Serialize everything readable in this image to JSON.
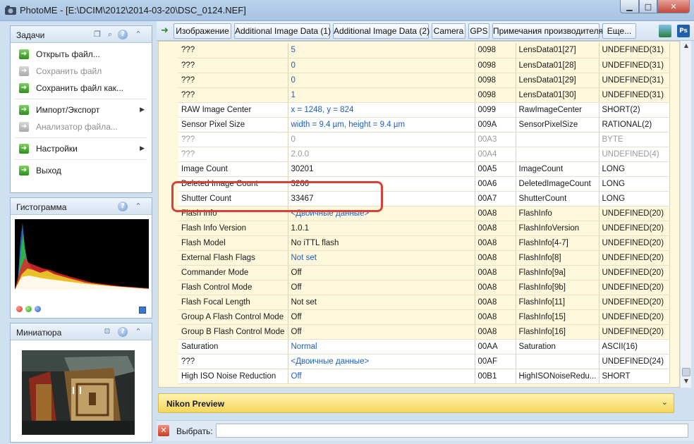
{
  "window": {
    "title": "PhotoME - [E:\\DCIM\\2012\\2014-03-20\\DSC_0124.NEF]",
    "minimize": "▁",
    "maximize": "□",
    "close": "✕"
  },
  "tasks": {
    "title": "Задачи",
    "items": [
      {
        "label": "Открыть файл...",
        "enabled": true
      },
      {
        "label": "Сохранить файл",
        "enabled": false
      },
      {
        "label": "Сохранить файл как...",
        "enabled": true
      },
      {
        "label": "Импорт/Экспорт",
        "enabled": true,
        "submenu": true
      },
      {
        "label": "Анализатор файла...",
        "enabled": false
      },
      {
        "label": "Настройки",
        "enabled": true,
        "submenu": true
      },
      {
        "label": "Выход",
        "enabled": true
      }
    ]
  },
  "histogram": {
    "title": "Гистограмма"
  },
  "thumbnail": {
    "title": "Миниатюра"
  },
  "toolbar": {
    "tabs": [
      "Изображение",
      "Additional Image Data (1)",
      "Additional Image Data (2)",
      "Camera",
      "GPS",
      "Примечания производителя",
      "Еще..."
    ],
    "ps_label": "Ps"
  },
  "table": {
    "rows": [
      {
        "name": "???",
        "value": "5",
        "code": "0098",
        "tag": "LensData01[27]",
        "type": "UNDEFINED(31)",
        "style": "yellow",
        "value_color": "blue",
        "muted": false
      },
      {
        "name": "???",
        "value": "0",
        "code": "0098",
        "tag": "LensData01[28]",
        "type": "UNDEFINED(31)",
        "style": "yellow",
        "value_color": "blue",
        "muted": false
      },
      {
        "name": "???",
        "value": "0",
        "code": "0098",
        "tag": "LensData01[29]",
        "type": "UNDEFINED(31)",
        "style": "yellow",
        "value_color": "blue",
        "muted": false
      },
      {
        "name": "???",
        "value": "1",
        "code": "0098",
        "tag": "LensData01[30]",
        "type": "UNDEFINED(31)",
        "style": "yellow",
        "value_color": "blue",
        "muted": false
      },
      {
        "name": "RAW Image Center",
        "value": "x = 1248, y = 824",
        "code": "0099",
        "tag": "RawImageCenter",
        "type": "SHORT(2)",
        "style": "white",
        "value_color": "blue",
        "muted": false
      },
      {
        "name": "Sensor Pixel Size",
        "value": "width = 9.4 µm, height = 9.4 µm",
        "code": "009A",
        "tag": "SensorPixelSize",
        "type": "RATIONAL(2)",
        "style": "white",
        "value_color": "blue",
        "muted": false
      },
      {
        "name": "???",
        "value": "0",
        "code": "00A3",
        "tag": "",
        "type": "BYTE",
        "style": "white",
        "value_color": "gray",
        "muted": true
      },
      {
        "name": "???",
        "value": "2.0.0",
        "code": "00A4",
        "tag": "",
        "type": "UNDEFINED(4)",
        "style": "white",
        "value_color": "gray",
        "muted": true
      },
      {
        "name": "Image Count",
        "value": "30201",
        "code": "00A5",
        "tag": "ImageCount",
        "type": "LONG",
        "style": "white",
        "value_color": "black",
        "muted": false
      },
      {
        "name": "Deleted Image Count",
        "value": "3266",
        "code": "00A6",
        "tag": "DeletedImageCount",
        "type": "LONG",
        "style": "white",
        "value_color": "black",
        "muted": false
      },
      {
        "name": "Shutter Count",
        "value": "33467",
        "code": "00A7",
        "tag": "ShutterCount",
        "type": "LONG",
        "style": "white",
        "value_color": "black",
        "muted": false
      },
      {
        "name": "Flash Info",
        "value": "<Двоичные данные>",
        "code": "00A8",
        "tag": "FlashInfo",
        "type": "UNDEFINED(20)",
        "style": "yellow",
        "value_color": "blue",
        "muted": false
      },
      {
        "name": "Flash Info Version",
        "value": "1.0.1",
        "code": "00A8",
        "tag": "FlashInfoVersion",
        "type": "UNDEFINED(20)",
        "style": "yellow",
        "value_color": "black",
        "muted": false
      },
      {
        "name": "Flash Model",
        "value": "No iTTL flash",
        "code": "00A8",
        "tag": "FlashInfo[4-7]",
        "type": "UNDEFINED(20)",
        "style": "yellow",
        "value_color": "black",
        "muted": false
      },
      {
        "name": "External Flash Flags",
        "value": "Not set",
        "code": "00A8",
        "tag": "FlashInfo[8]",
        "type": "UNDEFINED(20)",
        "style": "yellow",
        "value_color": "blue",
        "muted": false
      },
      {
        "name": "Commander Mode",
        "value": "Off",
        "code": "00A8",
        "tag": "FlashInfo[9a]",
        "type": "UNDEFINED(20)",
        "style": "yellow",
        "value_color": "black",
        "muted": false
      },
      {
        "name": "Flash Control Mode",
        "value": "Off",
        "code": "00A8",
        "tag": "FlashInfo[9b]",
        "type": "UNDEFINED(20)",
        "style": "yellow",
        "value_color": "black",
        "muted": false
      },
      {
        "name": "Flash Focal Length",
        "value": "Not set",
        "code": "00A8",
        "tag": "FlashInfo[11]",
        "type": "UNDEFINED(20)",
        "style": "yellow",
        "value_color": "black",
        "muted": false
      },
      {
        "name": "Group A Flash Control Mode",
        "value": "Off",
        "code": "00A8",
        "tag": "FlashInfo[15]",
        "type": "UNDEFINED(20)",
        "style": "yellow",
        "value_color": "black",
        "muted": false
      },
      {
        "name": "Group B Flash Control Mode",
        "value": "Off",
        "code": "00A8",
        "tag": "FlashInfo[16]",
        "type": "UNDEFINED(20)",
        "style": "yellow",
        "value_color": "black",
        "muted": false
      },
      {
        "name": "Saturation",
        "value": "Normal",
        "code": "00AA",
        "tag": "Saturation",
        "type": "ASCII(16)",
        "style": "white",
        "value_color": "blue",
        "muted": false
      },
      {
        "name": "???",
        "value": "<Двоичные данные>",
        "code": "00AF",
        "tag": "",
        "type": "UNDEFINED(24)",
        "style": "white",
        "value_color": "blue",
        "muted": false
      },
      {
        "name": "High ISO Noise Reduction",
        "value": "Off",
        "code": "00B1",
        "tag": "HighISONoiseRedu...",
        "type": "SHORT",
        "style": "white",
        "value_color": "blue",
        "muted": false
      }
    ]
  },
  "preview": {
    "title": "Nikon Preview"
  },
  "bottom": {
    "label": "Выбрать:",
    "input_value": ""
  },
  "colors": {
    "accent_blue": "#1d5fc2",
    "highlight_red": "#d6423a",
    "yellow_row": "#fdf7dc",
    "preview_bar": "#f5d65c"
  }
}
